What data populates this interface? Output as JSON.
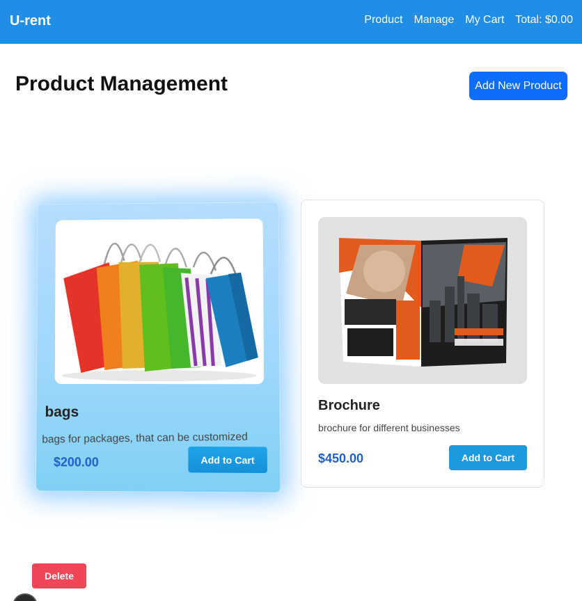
{
  "app": {
    "brand": "U-rent"
  },
  "nav": {
    "items": [
      {
        "label": "Product"
      },
      {
        "label": "Manage"
      },
      {
        "label": "My Cart"
      },
      {
        "label": "Total: $0.00"
      }
    ]
  },
  "header": {
    "title": "Product Management",
    "add_label": "Add New Product"
  },
  "products": [
    {
      "title": "bags",
      "description": "bags for packages, that can be customized",
      "price": "$200.00",
      "cart_label": "Add to Cart",
      "image_icon": "shopping-bags-image"
    },
    {
      "title": "Brochure",
      "description": "brochure for different businesses",
      "price": "$450.00",
      "cart_label": "Add to Cart",
      "image_icon": "brochure-image"
    }
  ],
  "actions": {
    "delete_label": "Delete"
  },
  "colors": {
    "navbar": "#208ee6",
    "primary_button": "#0d6efd",
    "cart_button": "#1b9ae0",
    "price": "#1f5fc6",
    "delete_button": "#f0465a"
  }
}
